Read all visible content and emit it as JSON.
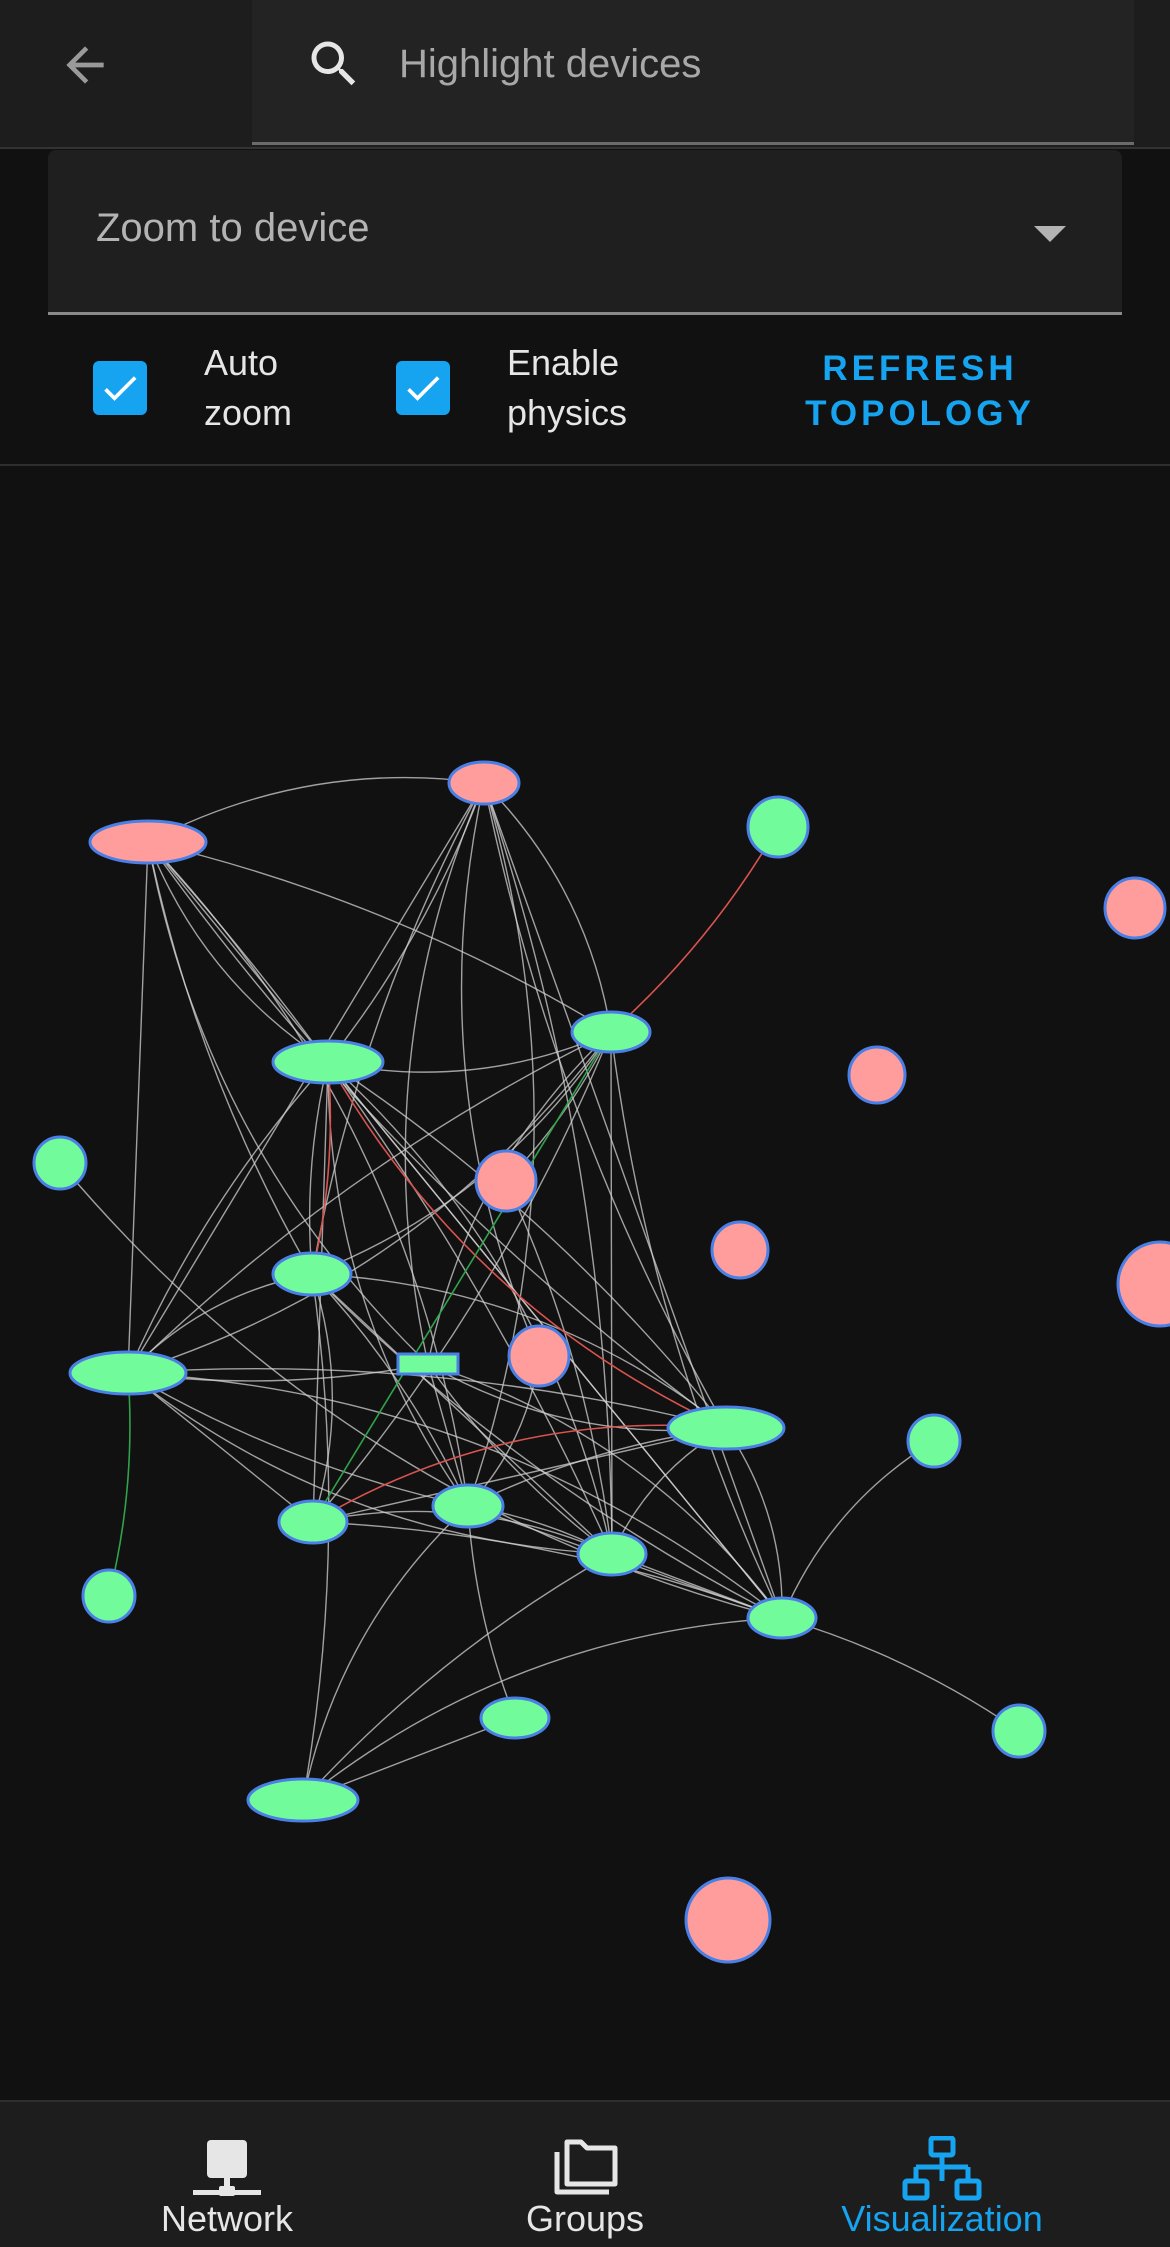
{
  "header": {
    "back_icon": "arrow-left-icon",
    "search": {
      "placeholder": "Highlight devices",
      "value": ""
    }
  },
  "zoom_select": {
    "label": "Zoom to device"
  },
  "options": {
    "auto_zoom": {
      "label": "Auto zoom",
      "checked": true
    },
    "enable_physics": {
      "label": "Enable physics",
      "checked": true
    },
    "refresh_label": "REFRESH TOPOLOGY"
  },
  "colors": {
    "accent": "#16a3f0",
    "node_up": "#72fb9a",
    "node_down": "#ff9c9c",
    "node_border": "#4a7fe6"
  },
  "graph": {
    "nodes": [
      {
        "id": "n1",
        "status": "down",
        "shape": "ellipse"
      },
      {
        "id": "n2",
        "status": "down",
        "shape": "ellipse"
      },
      {
        "id": "n3",
        "status": "up",
        "shape": "circle"
      },
      {
        "id": "n4",
        "status": "down",
        "shape": "circle"
      },
      {
        "id": "n5",
        "status": "up",
        "shape": "ellipse"
      },
      {
        "id": "n6",
        "status": "up",
        "shape": "ellipse"
      },
      {
        "id": "n7",
        "status": "down",
        "shape": "circle"
      },
      {
        "id": "n8",
        "status": "up",
        "shape": "circle"
      },
      {
        "id": "n9",
        "status": "down",
        "shape": "circle"
      },
      {
        "id": "n10",
        "status": "down",
        "shape": "circle"
      },
      {
        "id": "n11",
        "status": "down",
        "shape": "circle"
      },
      {
        "id": "n12",
        "status": "up",
        "shape": "ellipse"
      },
      {
        "id": "n13",
        "status": "up",
        "shape": "box"
      },
      {
        "id": "n14",
        "status": "down",
        "shape": "circle"
      },
      {
        "id": "n15",
        "status": "up",
        "shape": "ellipse"
      },
      {
        "id": "n16",
        "status": "up",
        "shape": "ellipse"
      },
      {
        "id": "n17",
        "status": "up",
        "shape": "circle"
      },
      {
        "id": "n18",
        "status": "up",
        "shape": "ellipse"
      },
      {
        "id": "n19",
        "status": "up",
        "shape": "ellipse"
      },
      {
        "id": "n20",
        "status": "up",
        "shape": "ellipse"
      },
      {
        "id": "n21",
        "status": "up",
        "shape": "circle"
      },
      {
        "id": "n22",
        "status": "up",
        "shape": "ellipse"
      },
      {
        "id": "n23",
        "status": "up",
        "shape": "ellipse"
      },
      {
        "id": "n24",
        "status": "up",
        "shape": "ellipse"
      },
      {
        "id": "n25",
        "status": "up",
        "shape": "circle"
      },
      {
        "id": "n26",
        "status": "up",
        "shape": "circle"
      },
      {
        "id": "n27",
        "status": "down",
        "shape": "circle"
      }
    ]
  },
  "bottom_nav": {
    "items": [
      {
        "label": "Network",
        "icon": "network-device-icon",
        "active": false
      },
      {
        "label": "Groups",
        "icon": "folders-icon",
        "active": false
      },
      {
        "label": "Visualization",
        "icon": "topology-icon",
        "active": true
      }
    ]
  }
}
